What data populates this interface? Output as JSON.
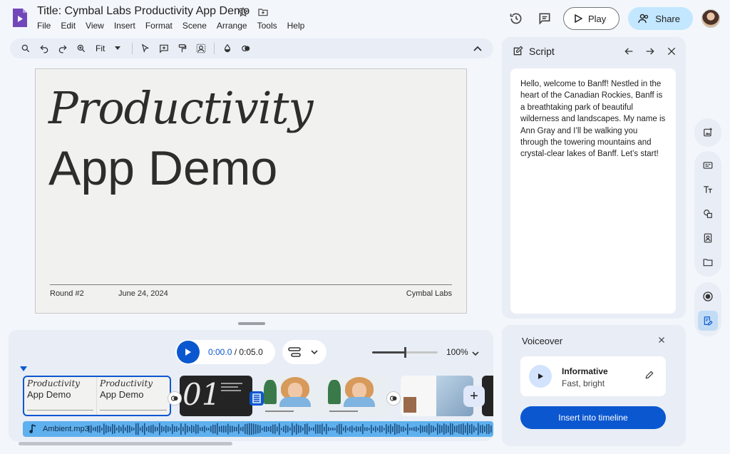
{
  "app": {
    "title": "Title: Cymbal Labs Productivity App Demo",
    "menus": [
      "File",
      "Edit",
      "View",
      "Insert",
      "Format",
      "Scene",
      "Arrange",
      "Tools",
      "Help"
    ],
    "play_label": "Play",
    "share_label": "Share"
  },
  "toolbar": {
    "zoom_value": "Fit"
  },
  "slide": {
    "title_line1": "Productivity",
    "title_line2": "App Demo",
    "footer_left": "Round #2",
    "footer_date": "June 24, 2024",
    "footer_right": "Cymbal Labs"
  },
  "timeline": {
    "current_time": "0:00.0",
    "total_time": " / 0:05.0",
    "zoom_label": "100%",
    "zoom_fraction": 0.5,
    "clip1": {
      "line1": "Productivity",
      "line2": "App Demo"
    },
    "clip2_number": "01",
    "audio_label": "Ambient.mp3"
  },
  "script": {
    "title": "Script",
    "text": "Hello, welcome to Banff! Nestled in the heart of the Canadian Rockies, Banff is a breathtaking park of beautiful wilderness and landscapes. My name is Ann Gray and I’ll be walking you through the towering mountains and crystal-clear lakes of Banff. Let’s start!"
  },
  "voiceover": {
    "title": "Voiceover",
    "voice_name": "Informative",
    "voice_desc": "Fast, bright",
    "insert_label": "Insert into timeline"
  },
  "colors": {
    "accent": "#0b57d0",
    "share_bg": "#c2e7ff",
    "audio_track": "#5fb0ee",
    "logo": "#7248b9"
  },
  "icons": {
    "rail_group1": [
      "add-image-icon"
    ],
    "rail_group2": [
      "subtitles-icon",
      "text-icon",
      "shapes-icon",
      "media-library-icon",
      "folder-icon"
    ],
    "rail_group3": [
      "record-icon",
      "script-icon"
    ]
  }
}
